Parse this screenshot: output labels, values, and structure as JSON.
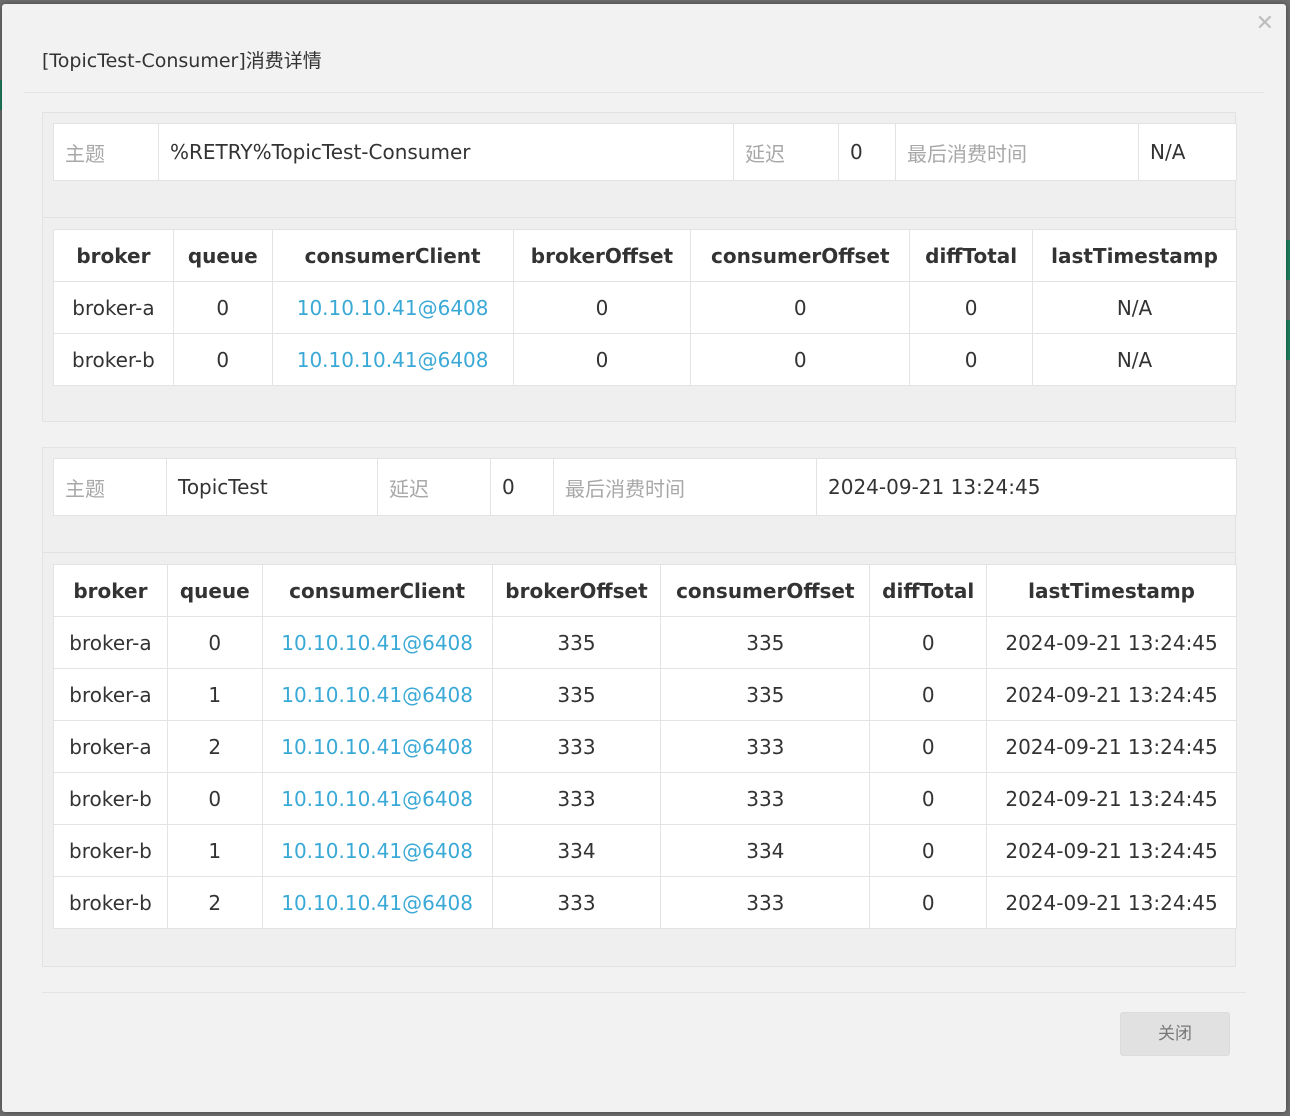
{
  "dialog": {
    "title": "[TopicTest-Consumer]消费详情",
    "close_label": "关闭",
    "close_icon": "close-icon"
  },
  "columns": [
    "broker",
    "queue",
    "consumerClient",
    "brokerOffset",
    "consumerOffset",
    "diffTotal",
    "lastTimestamp"
  ],
  "info_labels": {
    "topic": "主题",
    "delay": "延迟",
    "last_consume_time": "最后消费时间"
  },
  "colors": {
    "link": "#3aa9d6",
    "label": "#a8a8a8"
  },
  "groups": [
    {
      "topic": "%RETRY%TopicTest-Consumer",
      "delay": "0",
      "last_consume_time": "N/A",
      "rows": [
        [
          "broker-a",
          "0",
          "10.10.10.41@6408",
          "0",
          "0",
          "0",
          "N/A"
        ],
        [
          "broker-b",
          "0",
          "10.10.10.41@6408",
          "0",
          "0",
          "0",
          "N/A"
        ]
      ]
    },
    {
      "topic": "TopicTest",
      "delay": "0",
      "last_consume_time": "2024-09-21 13:24:45",
      "rows": [
        [
          "broker-a",
          "0",
          "10.10.10.41@6408",
          "335",
          "335",
          "0",
          "2024-09-21 13:24:45"
        ],
        [
          "broker-a",
          "1",
          "10.10.10.41@6408",
          "335",
          "335",
          "0",
          "2024-09-21 13:24:45"
        ],
        [
          "broker-a",
          "2",
          "10.10.10.41@6408",
          "333",
          "333",
          "0",
          "2024-09-21 13:24:45"
        ],
        [
          "broker-b",
          "0",
          "10.10.10.41@6408",
          "333",
          "333",
          "0",
          "2024-09-21 13:24:45"
        ],
        [
          "broker-b",
          "1",
          "10.10.10.41@6408",
          "334",
          "334",
          "0",
          "2024-09-21 13:24:45"
        ],
        [
          "broker-b",
          "2",
          "10.10.10.41@6408",
          "333",
          "333",
          "0",
          "2024-09-21 13:24:45"
        ]
      ]
    }
  ]
}
